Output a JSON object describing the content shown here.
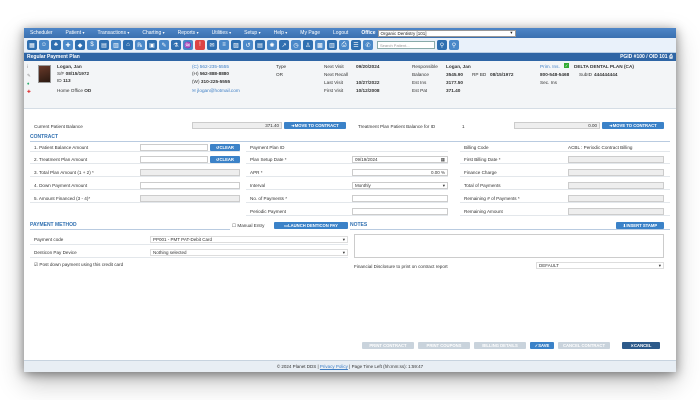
{
  "menu": {
    "items": [
      "Scheduler",
      "Patient",
      "Transactions",
      "Charting",
      "Reports",
      "Utilities",
      "Setup",
      "Help",
      "My Page",
      "Logout"
    ],
    "office_label": "Office",
    "office_value": "Organic Dentistry [101]"
  },
  "toolbar": {
    "search_placeholder": "Search Patient..."
  },
  "title": {
    "left": "Regular Payment Plan",
    "right": "PGID #100 / OID 101"
  },
  "patient": {
    "name": "Logan, Jan",
    "sex_dob_label": "S/F",
    "dob": "08/15/1972",
    "id_label": "ID",
    "id": "113",
    "home_office_label": "Home Office",
    "home_office": "OD",
    "phone_c": "(C) 562-235-5555",
    "phone_h_label": "(H)",
    "phone_h": "562-888-8880",
    "phone_w_label": "(W)",
    "phone_w": "310-225-5555",
    "email": "jlogan@hotmail.com",
    "type_label": "Type",
    "type": "OR",
    "next_visit_label": "Next Visit",
    "next_visit": "09/20/2024",
    "next_recall_label": "Next Recall",
    "next_recall": "",
    "last_visit_label": "Last Visit",
    "last_visit": "10/27/2022",
    "first_visit_label": "First Visit",
    "first_visit": "10/12/2008",
    "responsible_label": "Responsible",
    "responsible": "Logan, Jan",
    "balance_label": "Balance",
    "balance": "3545.90",
    "rp_bd_label": "RP BD",
    "rp_bd": "08/15/1972",
    "est_ins_label": "Est Ins",
    "est_ins": "3177.50",
    "est_pat_label": "Est Pat",
    "est_pat": "371.40",
    "prim_ins_label": "Prim. Ins.",
    "prim_ins": "DELTA DENTAL PLAN (CA)",
    "prim_phone": "800-548-5468",
    "subid_label": "SubID",
    "subid": "444444444",
    "sec_ins_label": "Sec. Ins"
  },
  "balances": {
    "current_label": "Current Patient Balance",
    "current_value": "371.40",
    "move_label": "MOVE TO CONTRACT",
    "treat_label": "Treatment Plan Patient Balance for ID",
    "treat_id": "1",
    "treat_value": "0.00"
  },
  "contract": {
    "header": "CONTRACT",
    "left": [
      {
        "label": "1. Patient Balance Amount",
        "value": "",
        "btn": "CLEAR"
      },
      {
        "label": "2. Treatment Plan Amount",
        "value": "",
        "btn": "CLEAR"
      },
      {
        "label": "3. Total Plan Amount (1 + 2) *",
        "value": ""
      },
      {
        "label": "4. Down Payment Amount",
        "value": ""
      },
      {
        "label": "5. Amount Financed (3 - 4)*",
        "value": ""
      }
    ],
    "mid": [
      {
        "label": "Payment Plan ID",
        "value": ""
      },
      {
        "label": "Plan Setup Date *",
        "value": "09/19/2024"
      },
      {
        "label": "APR *",
        "value": "0.00 %"
      },
      {
        "label": "Interval",
        "value": "Monthly"
      },
      {
        "label": "No. of Payments *",
        "value": ""
      },
      {
        "label": "Periodic Payment",
        "value": ""
      }
    ],
    "right": [
      {
        "label": "Billing Code",
        "value": "ACBL : Periodic Contract Billing"
      },
      {
        "label": "First Billing Date *",
        "value": ""
      },
      {
        "label": "Finance Charge",
        "value": ""
      },
      {
        "label": "Total of Payments",
        "value": ""
      },
      {
        "label": "Remaining # of Payments *",
        "value": ""
      },
      {
        "label": "Remaining Amount",
        "value": ""
      }
    ]
  },
  "payment": {
    "header": "PAYMENT METHOD",
    "manual_entry": "Manual Entry",
    "launch_label": "LAUNCH DENTICON PAY",
    "code_label": "Payment code",
    "code_value": "PP001 - PMT PAT-Debit Card",
    "device_label": "Denticon Pay Device",
    "device_value": "Nothing selected",
    "post_label": "Post down payment using this credit card"
  },
  "notes": {
    "header": "NOTES",
    "insert_label": "INSERT STAMP",
    "disclosure_label": "Financial Disclosure to print on contract report",
    "disclosure_value": "DEFAULT"
  },
  "actions": {
    "print": "PRINT CONTRACT",
    "coupons": "PRINT COUPONS",
    "ledger": "BILLING DETAILS",
    "cancel_contract": "CANCEL CONTRACT",
    "save": "SAVE",
    "cancel": "CANCEL"
  },
  "footer": {
    "copyright": "© 2024 Planet DDS |",
    "privacy": "Privacy Policy",
    "session": "| Page Time Left (hh:mm:ss): 1:59:47"
  },
  "colors": {
    "accent": "#3b82c8",
    "header": "#2e65a5"
  }
}
